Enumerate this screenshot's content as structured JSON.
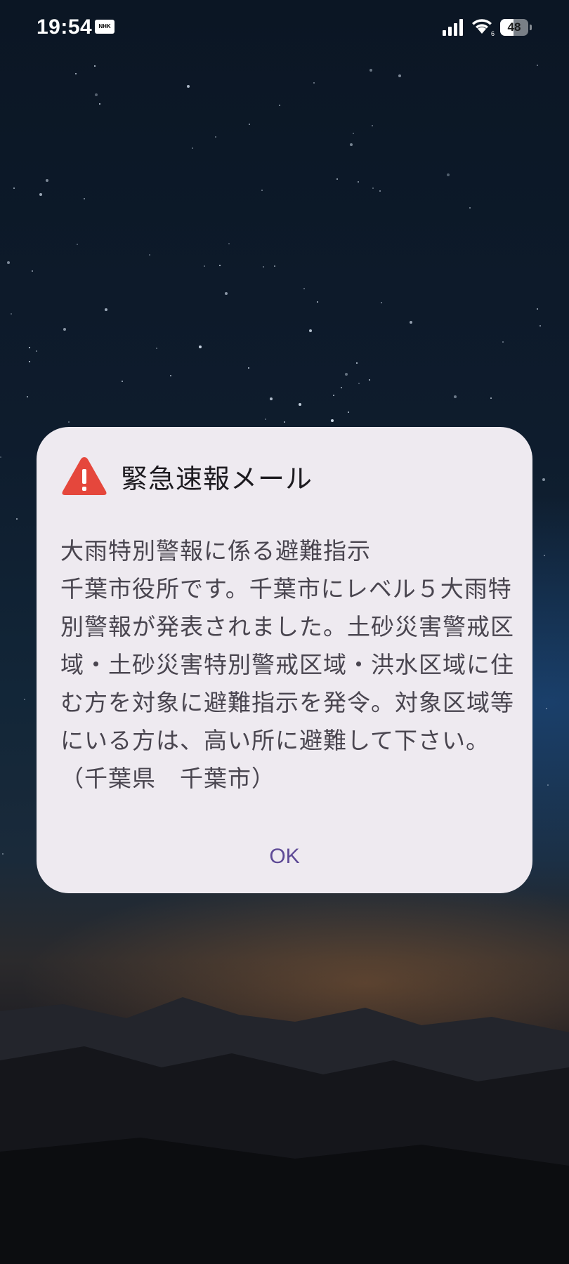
{
  "status_bar": {
    "time": "19:54",
    "notification_badge": "NHK",
    "signal_icon": "cellular-signal-icon",
    "wifi_icon": "wifi-icon",
    "battery_level": "48",
    "battery_fraction": 0.48
  },
  "alert": {
    "icon": "warning-triangle-icon",
    "icon_color": "#e5473c",
    "title": "緊急速報メール",
    "headline": "大雨特別警報に係る避難指示",
    "message": "千葉市役所です。千葉市にレベル５大雨特別警報が発表されました。土砂災害警戒区域・土砂災害特別警戒区域・洪水区域に住む方を対象に避難指示を発令。対象区域等にいる方は、高い所に避難して下さい。",
    "footer": "（千葉県　千葉市）",
    "ok_label": "OK",
    "accent_color": "#5e4a96"
  }
}
